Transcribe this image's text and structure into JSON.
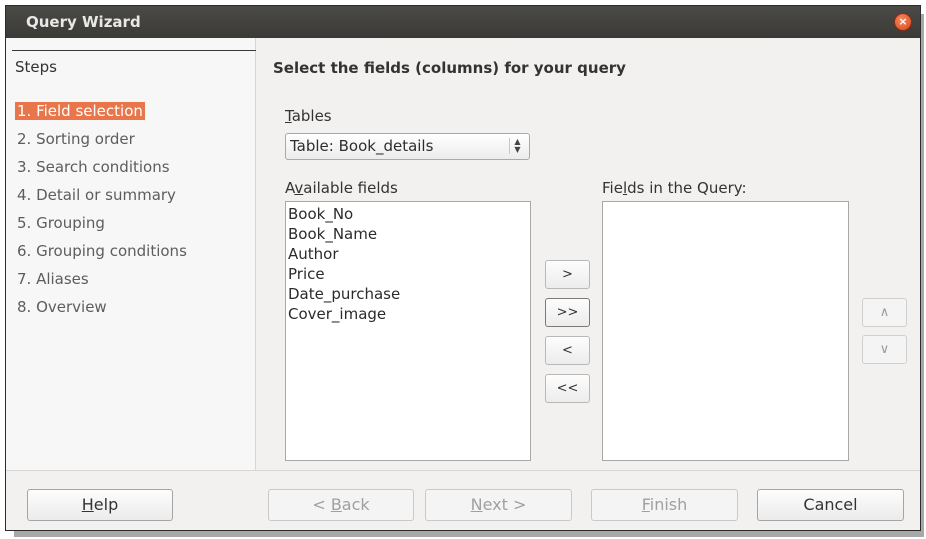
{
  "window": {
    "title": "Query Wizard",
    "close_symbol": "×"
  },
  "sidebar": {
    "heading": "Steps",
    "steps": [
      {
        "label": "1. Field selection",
        "active": true
      },
      {
        "label": "2. Sorting order",
        "active": false
      },
      {
        "label": "3. Search conditions",
        "active": false
      },
      {
        "label": "4. Detail or summary",
        "active": false
      },
      {
        "label": "5. Grouping",
        "active": false
      },
      {
        "label": "6. Grouping conditions",
        "active": false
      },
      {
        "label": "7. Aliases",
        "active": false
      },
      {
        "label": "8. Overview",
        "active": false
      }
    ]
  },
  "main": {
    "heading": "Select the fields (columns) for your query",
    "tables_label_mnemonic": "T",
    "tables_label_rest": "ables",
    "table_select_value": "Table: Book_details",
    "available_label_pre": "A",
    "available_label_mnemonic": "v",
    "available_label_rest": "ailable fields",
    "query_label_pre": "Fie",
    "query_label_mnemonic": "l",
    "query_label_rest": "ds in the Query:",
    "available_fields": [
      "Book_No",
      "Book_Name",
      "Author",
      "Price",
      "Date_purchase",
      "Cover_image"
    ],
    "query_fields": [],
    "move_buttons": {
      "add_one": ">",
      "add_all": ">>",
      "remove_one": "<",
      "remove_all": "<<"
    },
    "order_buttons": {
      "up": "∧",
      "down": "∨"
    }
  },
  "footer": {
    "help_mnemonic": "H",
    "help_rest": "elp",
    "back_pre": "< ",
    "back_mnemonic": "B",
    "back_rest": "ack",
    "next_mnemonic": "N",
    "next_rest": "ext >",
    "finish_mnemonic": "F",
    "finish_rest": "inish",
    "cancel": "Cancel"
  },
  "colors": {
    "active_step_bg": "#e8764a",
    "titlebar": "#3f3e3b",
    "close": "#e0532a"
  }
}
